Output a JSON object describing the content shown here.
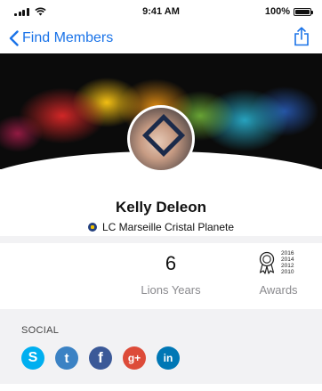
{
  "status_bar": {
    "time": "9:41 AM",
    "battery": "100%"
  },
  "nav": {
    "back_label": "Find Members",
    "back_icon": "chevron-left-icon",
    "share_icon": "share-icon"
  },
  "profile": {
    "name": "Kelly Deleon",
    "club": "LC Marseille Cristal Planete"
  },
  "stats": {
    "lions_years_value": "6",
    "lions_years_label": "Lions Years",
    "awards_label": "Awards",
    "award_years": [
      "2016",
      "2014",
      "2012",
      "2010"
    ]
  },
  "social": {
    "title": "SOCIAL",
    "networks": [
      {
        "name": "skype",
        "letter": "S",
        "color": "#00aff0"
      },
      {
        "name": "twitter",
        "letter": "t",
        "color": "#1da1f2"
      },
      {
        "name": "facebook",
        "letter": "f",
        "color": "#3b5998"
      },
      {
        "name": "google-plus",
        "letter": "g+",
        "color": "#dd4b39"
      },
      {
        "name": "linkedin",
        "letter": "in",
        "color": "#0077b5"
      }
    ]
  },
  "colors": {
    "accent": "#1a73e8",
    "section_bg": "#f2f2f4"
  }
}
